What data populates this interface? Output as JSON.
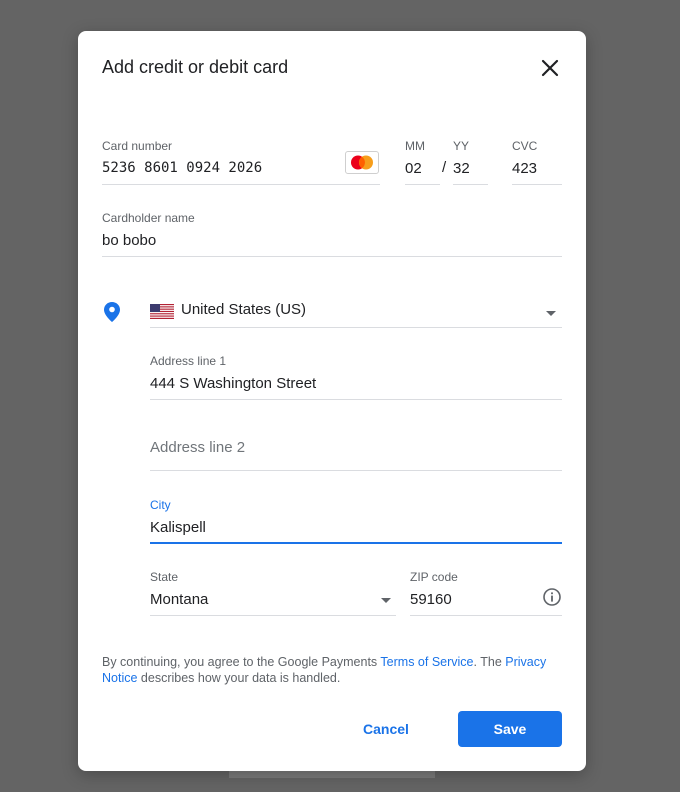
{
  "dialog": {
    "title": "Add credit or debit card",
    "close_icon": "close-icon"
  },
  "card": {
    "number_label": "Card number",
    "number_value": "5236 8601 0924 2026",
    "brand_icon": "mastercard-icon",
    "month_label": "MM",
    "month_value": "02",
    "year_label": "YY",
    "year_value": "32",
    "separator": "/",
    "cvc_label": "CVC",
    "cvc_value": "423"
  },
  "cardholder": {
    "label": "Cardholder name",
    "value": "bo bobo"
  },
  "address": {
    "location_icon": "location-pin-icon",
    "country": "United States (US)",
    "line1_label": "Address line 1",
    "line1_value": "444 S Washington Street",
    "line2_placeholder": "Address line 2",
    "city_label": "City",
    "city_value": "Kalispell",
    "state_label": "State",
    "state_value": "Montana",
    "zip_label": "ZIP code",
    "zip_value": "59160",
    "info_icon": "info-icon"
  },
  "disclaimer": {
    "prefix": "By continuing, you agree to the Google Payments ",
    "terms_link": "Terms of Service",
    "middle": ". The ",
    "privacy_link": "Privacy Notice",
    "suffix": " describes how your data is handled."
  },
  "actions": {
    "cancel_label": "Cancel",
    "save_label": "Save"
  },
  "colors": {
    "accent": "#1a73e8",
    "overlay": "#646464"
  }
}
